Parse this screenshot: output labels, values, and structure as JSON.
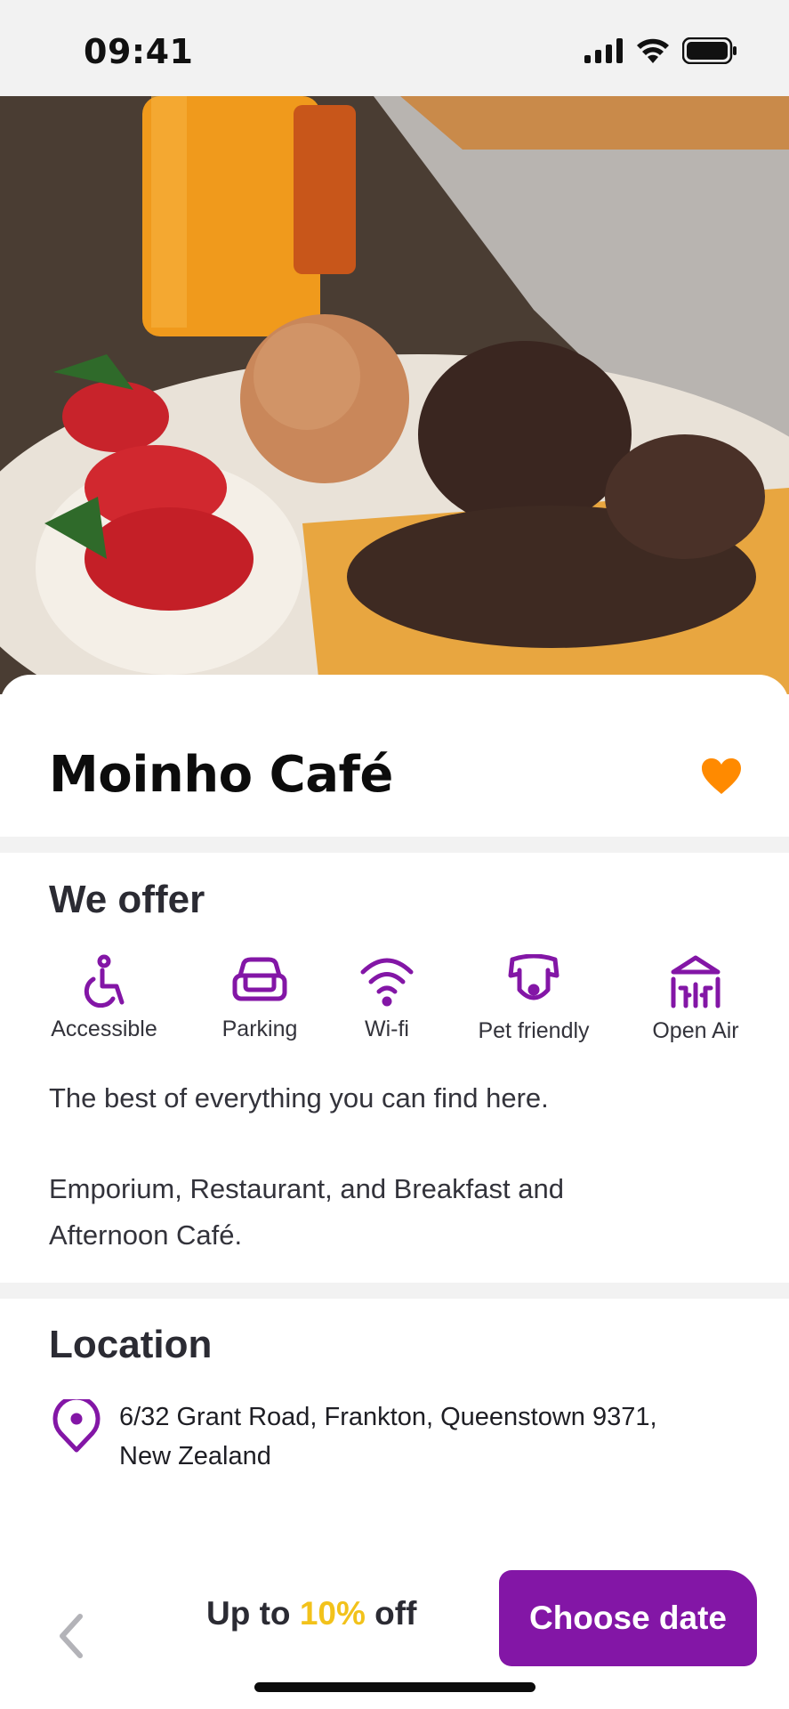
{
  "status_bar": {
    "time": "09:41"
  },
  "gallery": {
    "slide_count": 5,
    "active_slide": 1
  },
  "venue": {
    "name": "Moinho Café",
    "favorited": true
  },
  "offer": {
    "title": "We offer",
    "amenities": [
      {
        "icon": "accessible-icon",
        "label": "Accessible"
      },
      {
        "icon": "car-icon",
        "label": "Parking"
      },
      {
        "icon": "wifi-icon",
        "label": "Wi-fi"
      },
      {
        "icon": "dog-icon",
        "label": "Pet friendly"
      },
      {
        "icon": "tent-icon",
        "label": "Open Air"
      }
    ],
    "description_1": "The best of everything you can find here.",
    "description_2_line1": "Emporium, Restaurant, and Breakfast and",
    "description_2_line2": "Afternoon Café."
  },
  "location": {
    "title": "Location",
    "address_line1": "6/32 Grant Road, Frankton, Queenstown 9371,",
    "address_line2": "New Zealand"
  },
  "footer": {
    "discount_prefix": "Up to ",
    "discount_value": "10%",
    "discount_suffix": " off",
    "cta_label": "Choose date"
  },
  "colors": {
    "primary": "#8316a6",
    "accent": "#f2c21b",
    "favorite": "#ff8a00"
  }
}
